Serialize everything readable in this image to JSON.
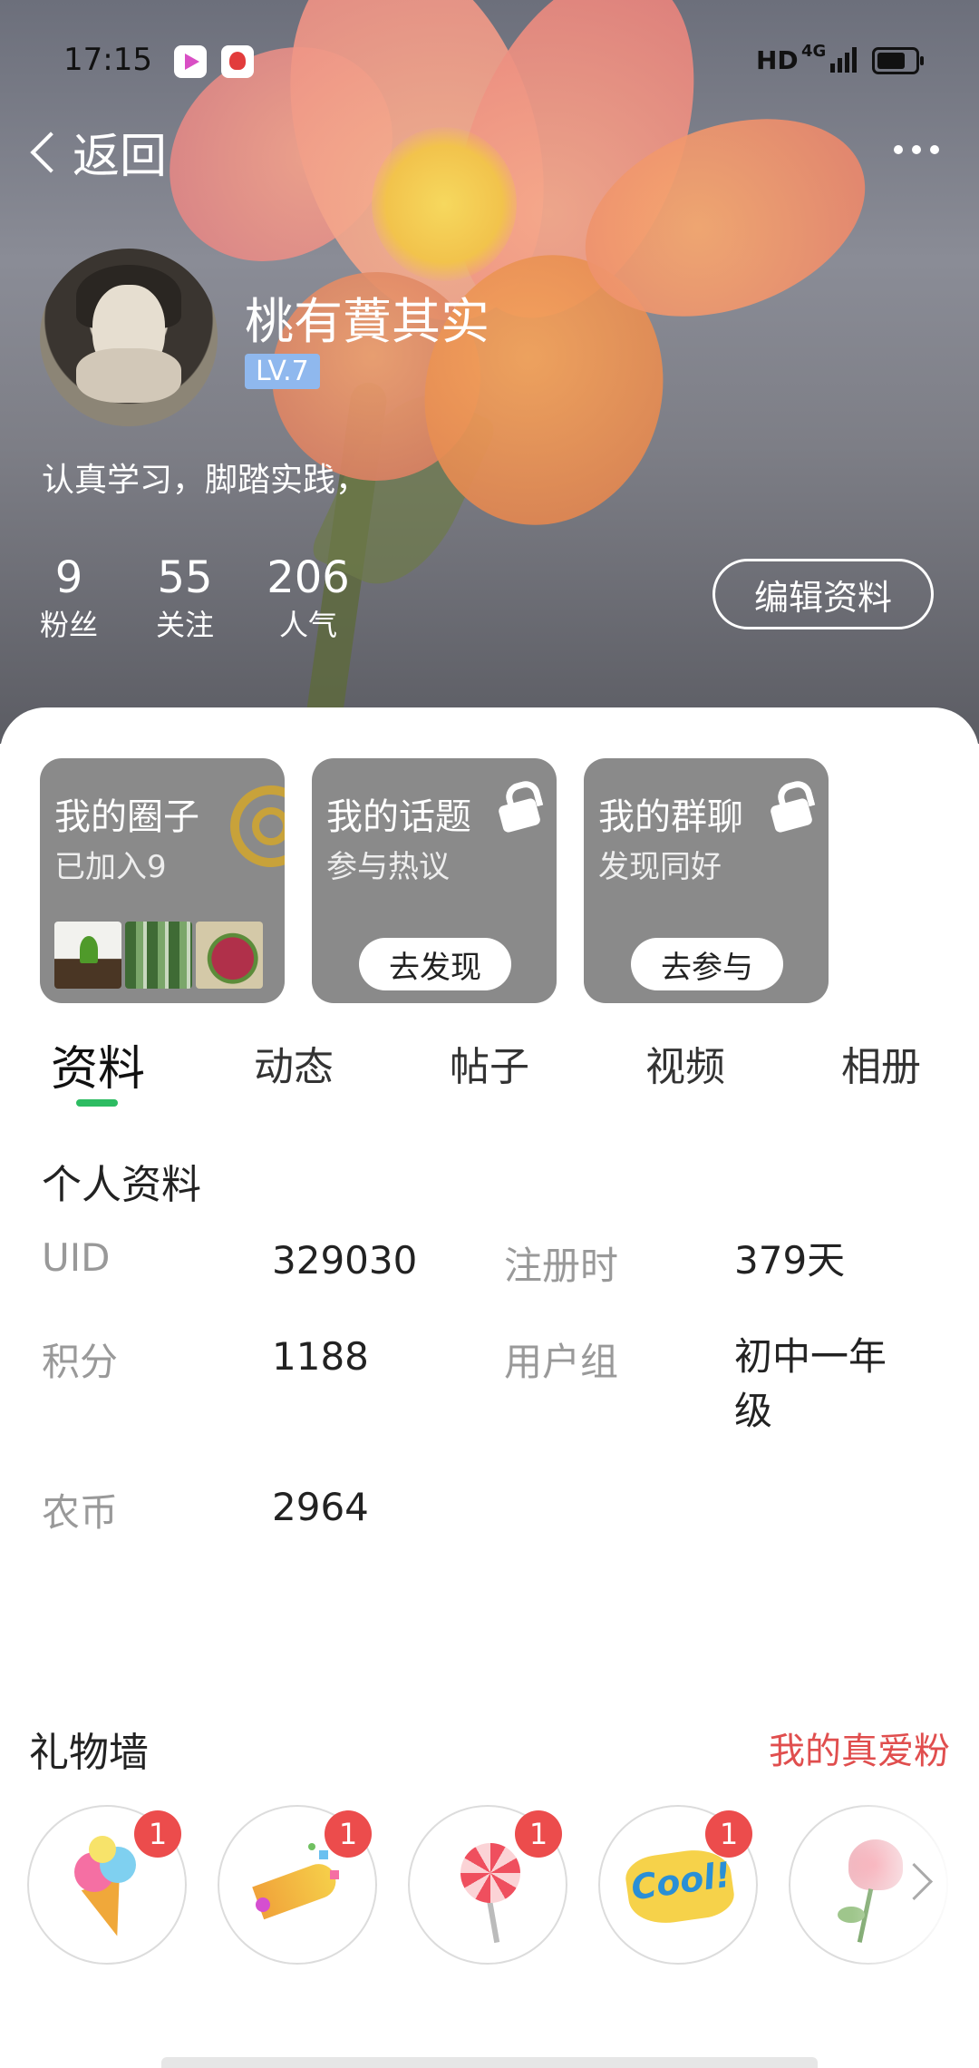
{
  "status_bar": {
    "time": "17:15",
    "hd": "HD",
    "network": "4G"
  },
  "nav": {
    "back_label": "返回"
  },
  "profile": {
    "name": "桃有蕡其实",
    "level": "LV.7",
    "bio": "认真学习，脚踏实践，",
    "stats": [
      {
        "value": "9",
        "label": "粉丝"
      },
      {
        "value": "55",
        "label": "关注"
      },
      {
        "value": "206",
        "label": "人气"
      }
    ],
    "edit_label": "编辑资料"
  },
  "cards": [
    {
      "title": "我的圈子",
      "subtitle": "已加入9"
    },
    {
      "title": "我的话题",
      "subtitle": "参与热议",
      "button": "去发现"
    },
    {
      "title": "我的群聊",
      "subtitle": "发现同好",
      "button": "去参与"
    }
  ],
  "tabs": [
    "资料",
    "动态",
    "帖子",
    "视频",
    "相册"
  ],
  "info": {
    "title": "个人资料",
    "rows": [
      {
        "label": "UID",
        "value": "329030",
        "label2": "注册时",
        "value2": "379天"
      },
      {
        "label": "积分",
        "value": "1188",
        "label2": "用户组",
        "value2": "初中一年级"
      },
      {
        "label": "农币",
        "value": "2964"
      }
    ]
  },
  "gifts": {
    "title": "礼物墙",
    "link": "我的真爱粉",
    "items": [
      {
        "name": "ice-cream",
        "count": "1"
      },
      {
        "name": "party-popper",
        "count": "1"
      },
      {
        "name": "lollipop",
        "count": "1"
      },
      {
        "name": "cool-sticker",
        "count": "1",
        "text": "Cool!"
      },
      {
        "name": "rose"
      }
    ]
  },
  "colors": {
    "accent_green": "#2dbc62",
    "link_red": "#e04e4e",
    "badge_red": "#ec4c4c",
    "level_blue": "#8fb8ee"
  }
}
